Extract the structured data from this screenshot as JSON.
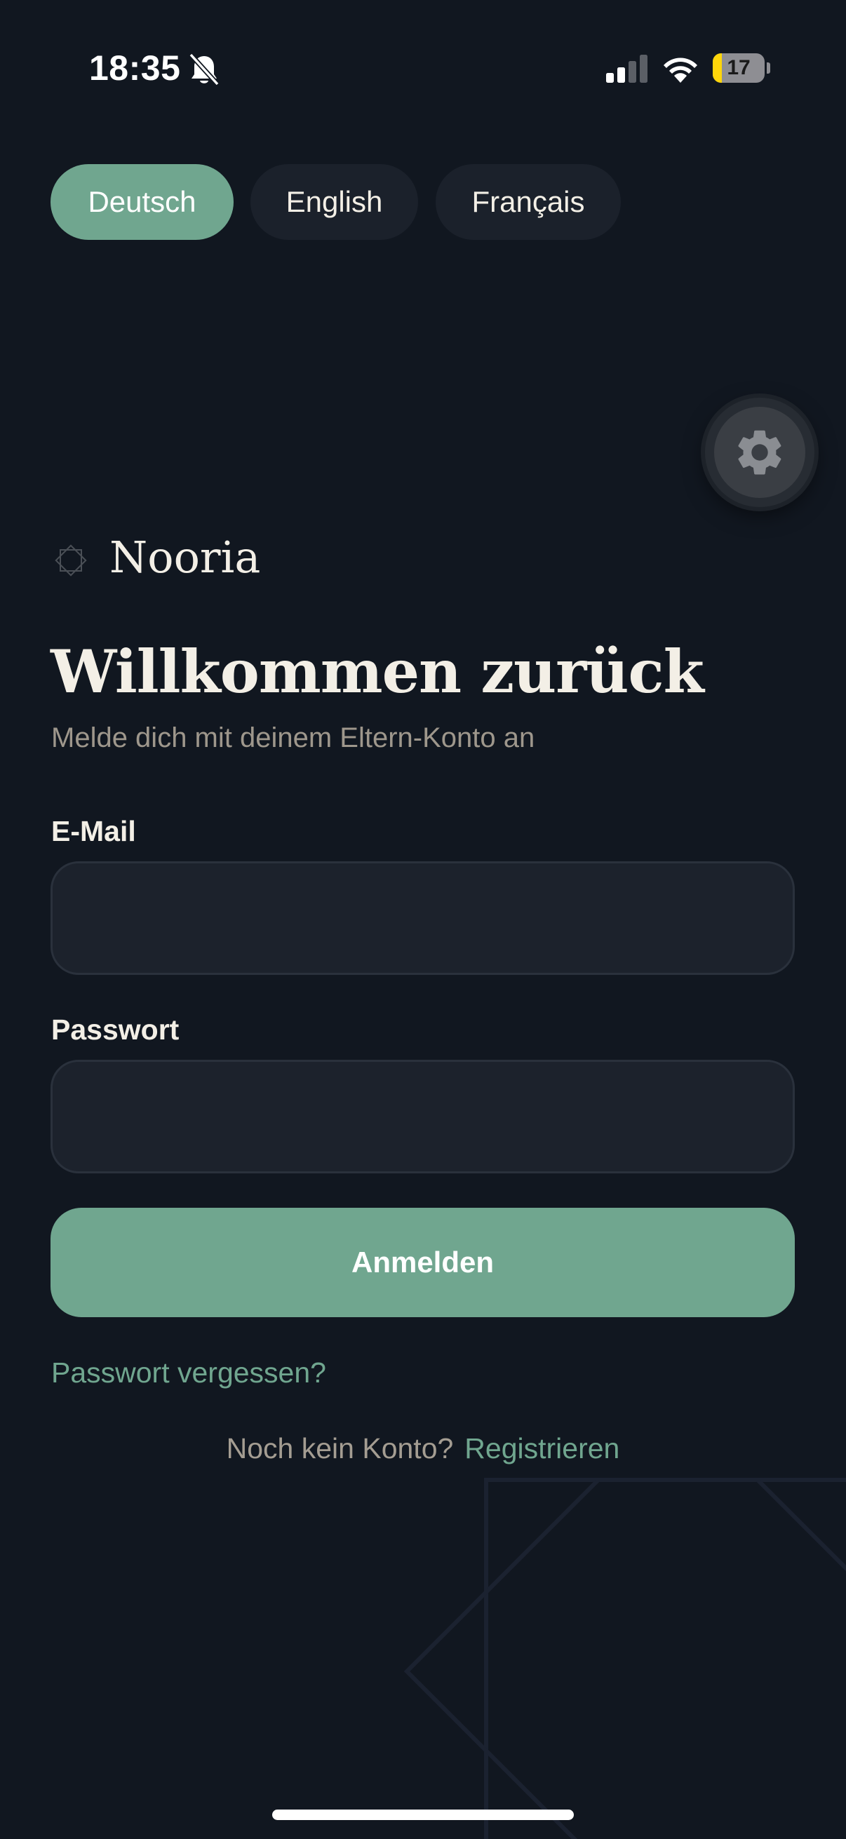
{
  "status_bar": {
    "time": "18:35",
    "mute_icon": "bell-slash-icon",
    "signal_icon": "cellular-signal-icon",
    "wifi_icon": "wifi-icon",
    "battery_level": 17,
    "battery_text": "17"
  },
  "languages": [
    {
      "label": "Deutsch",
      "active": true
    },
    {
      "label": "English",
      "active": false
    },
    {
      "label": "Français",
      "active": false
    }
  ],
  "settings": {
    "icon": "gear-icon"
  },
  "brand": {
    "icon": "octagram-logo-icon",
    "name": "Nooria"
  },
  "login": {
    "title": "Willkommen zurück",
    "subtitle": "Melde dich mit deinem Eltern-Konto an",
    "email_label": "E-Mail",
    "email_value": "",
    "password_label": "Passwort",
    "password_value": "",
    "submit_label": "Anmelden",
    "forgot_label": "Passwort vergessen?",
    "signup_prompt": "Noch kein Konto?",
    "signup_link": "Registrieren"
  },
  "colors": {
    "background": "#111720",
    "accent": "#70a68f",
    "input_bg": "#1c222c",
    "text": "#f3efe6",
    "muted_text": "#9e978c",
    "battery_fill": "#ffd60a"
  }
}
